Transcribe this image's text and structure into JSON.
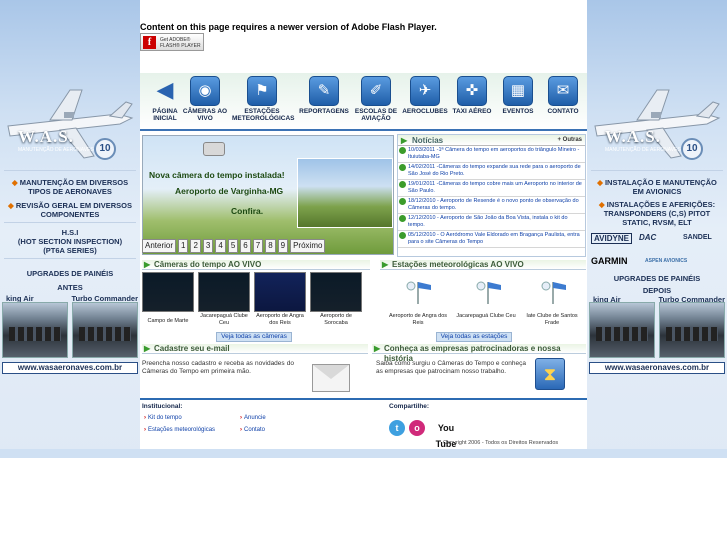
{
  "flash": {
    "message": "Content on this page requires a newer version of Adobe Flash Player.",
    "button_line1": "Get ADOBE®",
    "button_line2": "FLASH® PLAYER"
  },
  "left_ad": {
    "logo": "W.A.S.",
    "logo_sub": "MANUTENÇÃO DE AERONAVES",
    "badge": "10",
    "items": [
      "MANUTENÇÃO EM DIVERSOS TIPOS DE AERONAVES",
      "REVISÃO GERAL EM DIVERSOS COMPONENTES"
    ],
    "hsi_line1": "H.S.I",
    "hsi_line2": "(HOT SECTION INSPECTION)",
    "hsi_line3": "(PT6A SERIES)",
    "upgrades": "UPGRADES DE PAINÉIS",
    "before": "ANTES",
    "cockpit_left": "king Air",
    "cockpit_right": "Turbo Commander",
    "url": "www.wasaeronaves.com.br"
  },
  "right_ad": {
    "logo": "W.A.S.",
    "logo_sub": "MANUTENÇÃO DE AERONAVES",
    "badge": "10",
    "item1": "INSTALAÇÃO E MANUTENÇÃO EM AVIONICS",
    "item2": "INSTALAÇÕES E AFERIÇÕES: TRANSPONDERS (C,S) PITOT STATIC, RVSM, ELT",
    "brands": [
      "AVIDYNE",
      "DAC",
      "SANDEL",
      "GARMIN",
      "ASPEN AVIONICS"
    ],
    "upgrades": "UPGRADES DE PAINÉIS",
    "after": "DEPOIS",
    "cockpit_left": "king Air",
    "cockpit_right": "Turbo Commander",
    "url": "www.wasaeronaves.com.br"
  },
  "nav": [
    {
      "label": "PÁGINA INICIAL",
      "icon": "arrow-left-icon"
    },
    {
      "label": "CÂMERAS AO VIVO",
      "icon": "camera-icon"
    },
    {
      "label": "ESTAÇÕES METEOROLÓGICAS",
      "icon": "windsock-icon"
    },
    {
      "label": "REPORTAGENS",
      "icon": "microphone-icon"
    },
    {
      "label": "ESCOLAS DE AVIAÇÃO",
      "icon": "clipboard-icon"
    },
    {
      "label": "AEROCLUBES",
      "icon": "plane-icon"
    },
    {
      "label": "TAXI AÉREO",
      "icon": "helicopter-icon"
    },
    {
      "label": "EVENTOS",
      "icon": "calendar-icon"
    },
    {
      "label": "CONTATO",
      "icon": "mail-icon"
    }
  ],
  "featured": {
    "line1": "Nova câmera do tempo instalada!",
    "line2": "Aeroporto de Varginha-MG",
    "line3": "Confira."
  },
  "pager": {
    "prev": "Anterior",
    "pages": [
      "1",
      "2",
      "3",
      "4",
      "5",
      "6",
      "7",
      "8",
      "9"
    ],
    "next": "Próximo"
  },
  "news": {
    "title": "Notícias",
    "more": "+ Outras",
    "items": [
      "10/03/2011 -1ª Câmera do tempo em aeroportos do triângulo Mineiro - Ituiutaba-MG",
      "14/02/2011 -Câmeras do tempo expande sua rede para o aeroporto de São José do Rio Preto.",
      "19/01/2011 -Câmeras do tempo cobre mais um Aeroporto no interior de São Paulo.",
      "18/12/2010 - Aeroporto de Resende é o novo ponto de observação do Câmeras do tempo.",
      "12/12/2010 - Aeroporto de São João da Boa Vista, instala o kit do tempo.",
      "05/12/2010 - O Aeródromo Vale Eldorado em Bragança Paulista, entra para o site Câmeras do Tempo"
    ]
  },
  "cameras": {
    "title": "Câmeras do tempo AO VIVO",
    "items": [
      "Campo de Marte",
      "Jacarepaguá Clube Ceu",
      "Aeroporto de Angra dos Reis",
      "Aeroporto de Sorocaba"
    ],
    "see_all": "Veja todas as câmeras"
  },
  "stations": {
    "title": "Estações meteorológicas AO VIVO",
    "items": [
      "Aeroporto de Angra dos Reis",
      "Jacarepaguá Clube Ceu",
      "Iate Clube de Santos Frade"
    ],
    "see_all": "Veja todas as estações"
  },
  "register": {
    "title": "Cadastre seu e-mail",
    "text": "Preencha nosso cadastro e receba as novidades do Câmeras do Tempo em primeira mão."
  },
  "sponsors": {
    "title": "Conheça as empresas patrocinadoras e nossa história",
    "text": "Saiba como surgiu o Câmeras do Tempo e conheça as empresas que patrocinam nosso trabalho."
  },
  "footer": {
    "institucional": "Institucional:",
    "links_col1": [
      "Kit do tempo",
      "Estações meteorológicas"
    ],
    "links_col2": [
      "Anuncie",
      "Contato"
    ],
    "share": "Compartilhe:",
    "youtube": "You Tube",
    "copyright": "Copyright 2006 - Todos os Direitos Reservados"
  }
}
